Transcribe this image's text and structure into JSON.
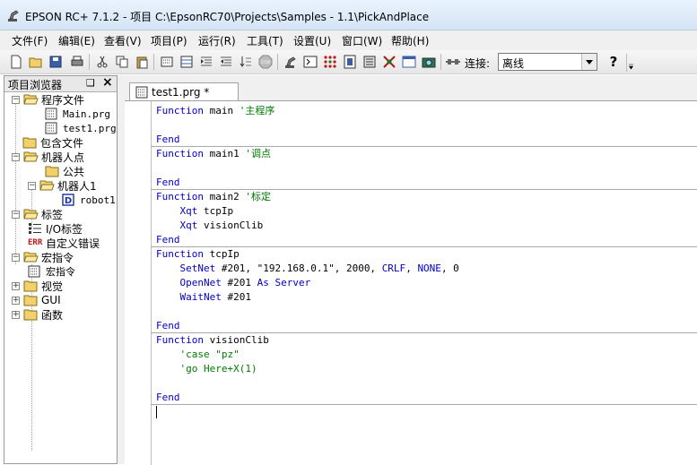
{
  "window": {
    "title": "EPSON RC+ 7.1.2 - 项目 C:\\EpsonRC70\\Projects\\Samples - 1.1\\PickAndPlace",
    "app_icon": "epson-robot-icon"
  },
  "menu": [
    {
      "id": "file",
      "label": "文件(F)"
    },
    {
      "id": "edit",
      "label": "编辑(E)"
    },
    {
      "id": "view",
      "label": "查看(V)"
    },
    {
      "id": "project",
      "label": "项目(P)"
    },
    {
      "id": "run",
      "label": "运行(R)"
    },
    {
      "id": "tools",
      "label": "工具(T)"
    },
    {
      "id": "setup",
      "label": "设置(U)"
    },
    {
      "id": "window",
      "label": "窗口(W)"
    },
    {
      "id": "help",
      "label": "帮助(H)"
    }
  ],
  "toolbar": {
    "connect_label": "连接:",
    "connect_value": "离线",
    "help_label": "?"
  },
  "project_explorer": {
    "title": "项目浏览器",
    "pin": "❑",
    "close": "×",
    "tree": [
      {
        "label": "程序文件",
        "type": "folder-open",
        "toggle": "−"
      },
      {
        "label": "Main.prg",
        "type": "prg"
      },
      {
        "label": "test1.prg",
        "type": "prg"
      },
      {
        "label": "包含文件",
        "type": "folder"
      },
      {
        "label": "机器人点",
        "type": "folder-open",
        "toggle": "−"
      },
      {
        "label": "公共",
        "type": "folder"
      },
      {
        "label": "机器人1",
        "type": "folder-open",
        "toggle": "−"
      },
      {
        "label": "robot1.",
        "type": "pts"
      },
      {
        "label": "标签",
        "type": "folder-open",
        "toggle": "−"
      },
      {
        "label": "I/O标签",
        "type": "io"
      },
      {
        "label": "自定义错误",
        "type": "err",
        "badge": "ERR"
      },
      {
        "label": "宏指令",
        "type": "folder-open",
        "toggle": "−"
      },
      {
        "label": "宏指令",
        "type": "prg"
      },
      {
        "label": "视觉",
        "type": "folder",
        "toggle": "+"
      },
      {
        "label": "GUI",
        "type": "folder",
        "toggle": "+"
      },
      {
        "label": "函数",
        "type": "folder",
        "toggle": "+"
      }
    ]
  },
  "editor": {
    "tab_label": "test1.prg *",
    "lines": [
      [
        {
          "t": "Function",
          "c": "kw"
        },
        {
          "t": " main ",
          "c": "id"
        },
        {
          "t": "'主程序",
          "c": "cm"
        }
      ],
      [],
      [
        {
          "t": "Fend",
          "c": "kw"
        }
      ],
      [
        {
          "t": "Function",
          "c": "kw"
        },
        {
          "t": " main1 ",
          "c": "id"
        },
        {
          "t": "'调点",
          "c": "cm"
        }
      ],
      [],
      [
        {
          "t": "Fend",
          "c": "kw"
        }
      ],
      [
        {
          "t": "Function",
          "c": "kw"
        },
        {
          "t": " main2 ",
          "c": "id"
        },
        {
          "t": "'标定",
          "c": "cm"
        }
      ],
      [
        {
          "t": "    ",
          "c": "id"
        },
        {
          "t": "Xqt",
          "c": "kw"
        },
        {
          "t": " tcpIp",
          "c": "id"
        }
      ],
      [
        {
          "t": "    ",
          "c": "id"
        },
        {
          "t": "Xqt",
          "c": "kw"
        },
        {
          "t": " visionClib",
          "c": "id"
        }
      ],
      [
        {
          "t": "Fend",
          "c": "kw"
        }
      ],
      [
        {
          "t": "Function",
          "c": "kw"
        },
        {
          "t": " tcpIp",
          "c": "id"
        }
      ],
      [
        {
          "t": "    ",
          "c": "id"
        },
        {
          "t": "SetNet",
          "c": "kw"
        },
        {
          "t": " #201, \"192.168.0.1\", 2000, ",
          "c": "id"
        },
        {
          "t": "CRLF",
          "c": "kw"
        },
        {
          "t": ", ",
          "c": "id"
        },
        {
          "t": "NONE",
          "c": "kw"
        },
        {
          "t": ", 0",
          "c": "id"
        }
      ],
      [
        {
          "t": "    ",
          "c": "id"
        },
        {
          "t": "OpenNet",
          "c": "kw"
        },
        {
          "t": " #201 ",
          "c": "id"
        },
        {
          "t": "As Server",
          "c": "kw"
        }
      ],
      [
        {
          "t": "    ",
          "c": "id"
        },
        {
          "t": "WaitNet",
          "c": "kw"
        },
        {
          "t": " #201",
          "c": "id"
        }
      ],
      [],
      [
        {
          "t": "Fend",
          "c": "kw"
        }
      ],
      [
        {
          "t": "Function",
          "c": "kw"
        },
        {
          "t": " visionClib",
          "c": "id"
        }
      ],
      [
        {
          "t": "    ",
          "c": "id"
        },
        {
          "t": "'case \"pz\"",
          "c": "cm"
        }
      ],
      [
        {
          "t": "    ",
          "c": "id"
        },
        {
          "t": "'go Here+X(1)",
          "c": "cm"
        }
      ],
      [],
      [
        {
          "t": "Fend",
          "c": "kw"
        }
      ],
      []
    ]
  },
  "colors": {
    "keyword": "#0000c8",
    "comment": "#007a00",
    "identifier": "#000000"
  }
}
